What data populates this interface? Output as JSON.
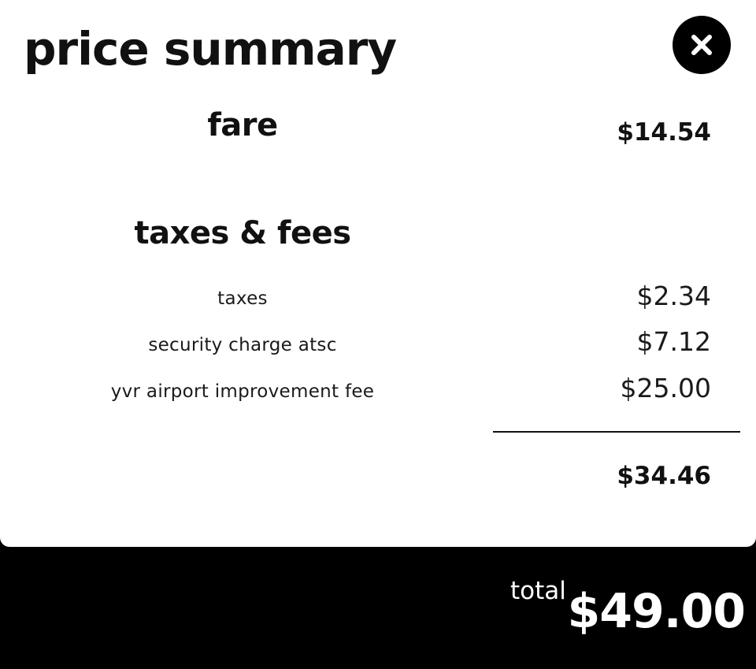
{
  "title": "price summary",
  "close_icon": "close-icon",
  "fare": {
    "label": "fare",
    "amount": "$14.54"
  },
  "taxes_fees": {
    "heading": "taxes & fees",
    "items": [
      {
        "label": "taxes",
        "amount": "$2.34"
      },
      {
        "label": "security charge atsc",
        "amount": "$7.12"
      },
      {
        "label": "yvr airport improvement fee",
        "amount": "$25.00"
      }
    ],
    "subtotal": "$34.46"
  },
  "total": {
    "label": "total",
    "amount": "$49.00"
  },
  "colors": {
    "text": "#111111",
    "panel": "#ffffff",
    "footer": "#000000"
  }
}
